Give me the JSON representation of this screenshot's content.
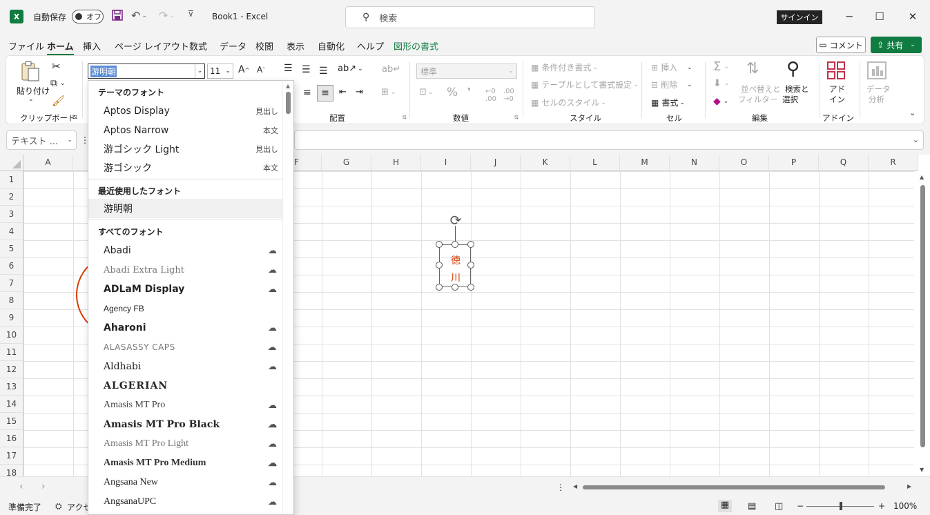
{
  "titlebar": {
    "logo": "X",
    "autosave_label": "自動保存",
    "autosave_state": "オフ",
    "doc_title": "Book1  -  Excel",
    "search_placeholder": "検索",
    "signin": "サインイン"
  },
  "menu": {
    "tabs": [
      "ファイル",
      "ホーム",
      "挿入",
      "ページ レイアウト",
      "数式",
      "データ",
      "校閲",
      "表示",
      "自動化",
      "ヘルプ",
      "図形の書式"
    ],
    "active": "ホーム",
    "comment": "コメント",
    "share": "共有"
  },
  "ribbon": {
    "paste": "貼り付け",
    "clipboard": "クリップボード",
    "font_name": "游明朝",
    "font_size": "11",
    "alignment": "配置",
    "number_format": "標準",
    "number": "数値",
    "conditional": "条件付き書式",
    "table_format": "テーブルとして書式設定",
    "cell_style": "セルのスタイル",
    "style": "スタイル",
    "insert": "挿入",
    "delete": "削除",
    "format": "書式",
    "cells": "セル",
    "sort_filter_1": "並べ替えと",
    "sort_filter_2": "フィルター",
    "find_select_1": "検索と",
    "find_select_2": "選択",
    "editing": "編集",
    "addin_1": "アド",
    "addin_2": "イン",
    "addin_group": "アドイン",
    "analyze_1": "データ",
    "analyze_2": "分析"
  },
  "formulabar": {
    "namebox": "テキスト ..."
  },
  "grid": {
    "columns": [
      "A",
      "F",
      "G",
      "H",
      "I",
      "J",
      "K",
      "L",
      "M",
      "N",
      "O",
      "P",
      "Q",
      "R"
    ],
    "rows": [
      "1",
      "2",
      "3",
      "4",
      "5",
      "6",
      "7",
      "8",
      "9",
      "10",
      "11",
      "12",
      "13",
      "14",
      "15",
      "16",
      "17",
      "18"
    ],
    "shape_text_1": "徳",
    "shape_text_2": "川"
  },
  "font_dropdown": {
    "theme_header": "テーマのフォント",
    "theme_fonts": [
      {
        "name": "Aptos Display",
        "tag": "見出し"
      },
      {
        "name": "Aptos Narrow",
        "tag": "本文"
      },
      {
        "name": "游ゴシック Light",
        "tag": "見出し"
      },
      {
        "name": "游ゴシック",
        "tag": "本文"
      }
    ],
    "recent_header": "最近使用したフォント",
    "recent_fonts": [
      "游明朝"
    ],
    "all_header": "すべてのフォント",
    "all_fonts": [
      "Abadi",
      "Abadi Extra Light",
      "ADLaM Display",
      "Agency FB",
      "Aharoni",
      "ALASASSY CAPS",
      "Aldhabi",
      "ALGERIAN",
      "Amasis MT Pro",
      "Amasis MT Pro Black",
      "Amasis MT Pro Light",
      "Amasis MT Pro Medium",
      "Angsana New",
      "AngsanaUPC"
    ]
  },
  "status": {
    "ready": "準備完了",
    "accessibility": "アクセ",
    "zoom": "100%"
  }
}
